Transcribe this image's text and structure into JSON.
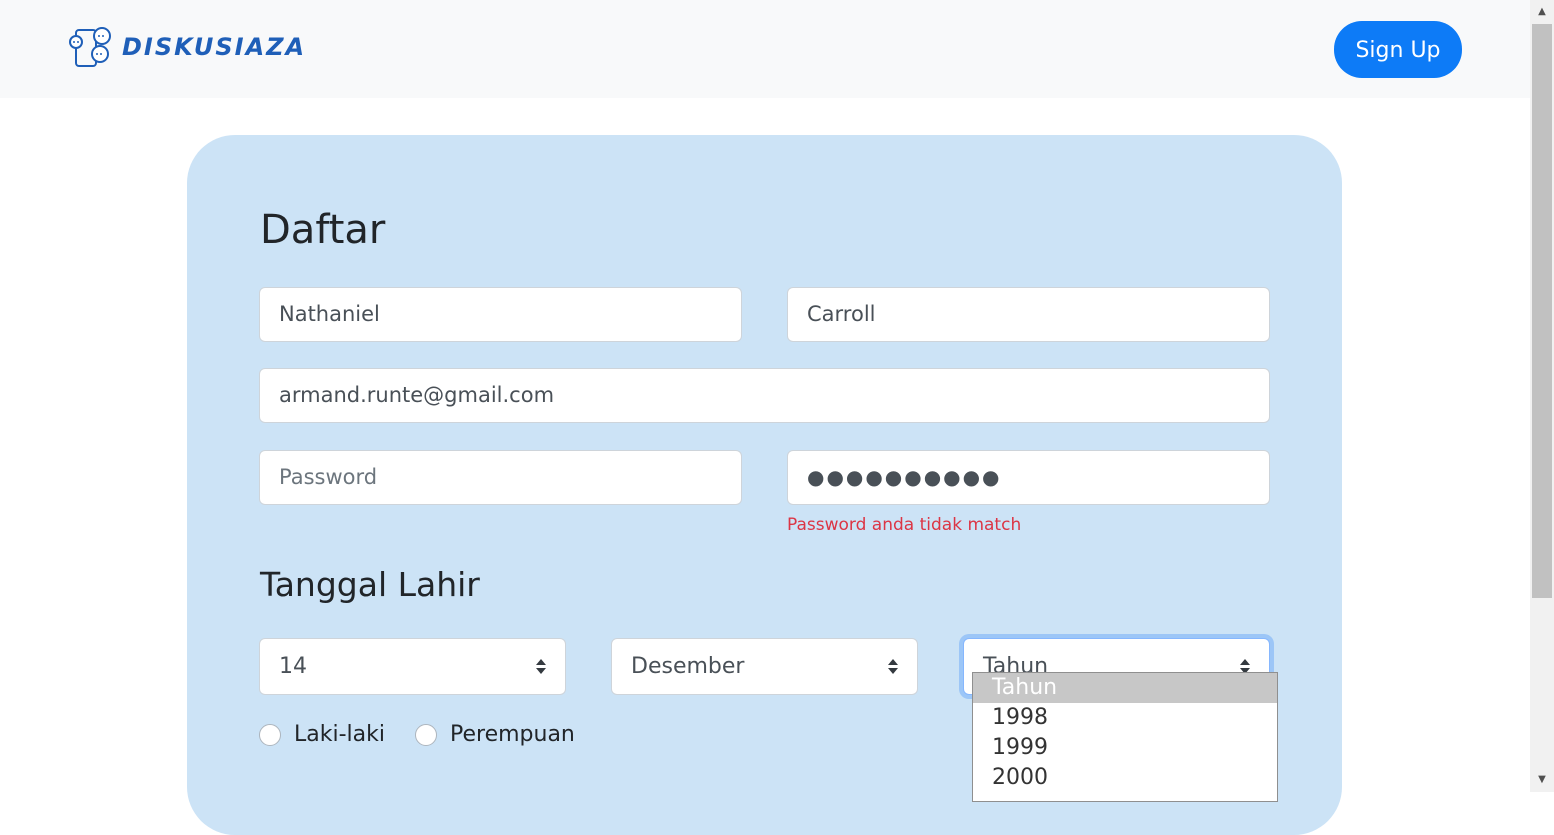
{
  "navbar": {
    "logo_text": "DISKUSIAZA",
    "signup_label": "Sign Up",
    "accent_color": "#0d7bf7"
  },
  "form": {
    "title": "Daftar",
    "first_name": {
      "value": "Nathaniel"
    },
    "last_name": {
      "value": "Carroll"
    },
    "email": {
      "value": "armand.runte@gmail.com"
    },
    "password": {
      "placeholder": "Password",
      "value": ""
    },
    "confirm_password": {
      "value": "●●●●●●●●●●"
    },
    "password_error": "Password anda tidak match",
    "birthdate_title": "Tanggal Lahir",
    "day_select": {
      "value": "14"
    },
    "month_select": {
      "value": "Desember"
    },
    "year_select": {
      "value": "Tahun",
      "options": [
        "Tahun",
        "1998",
        "1999",
        "2000"
      ],
      "highlighted_option": "Tahun"
    },
    "gender": {
      "options": [
        "Laki-laki",
        "Perempuan"
      ],
      "selected": null
    }
  },
  "colors": {
    "card_background": "#cce3f6",
    "error": "#dc3545"
  }
}
